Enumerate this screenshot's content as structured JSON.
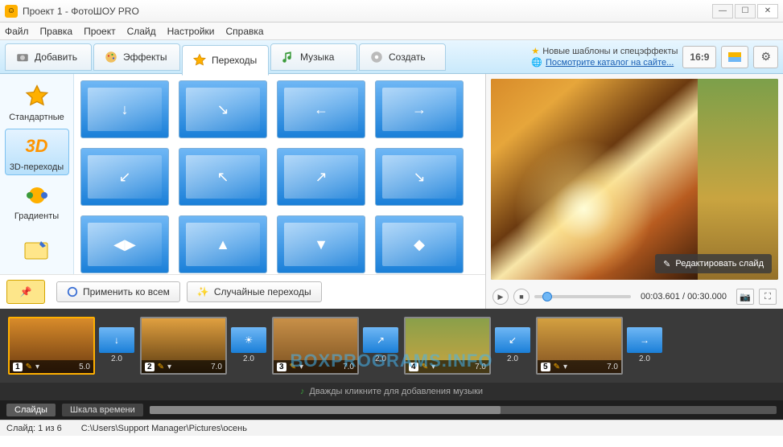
{
  "window": {
    "title": "Проект 1 - ФотоШОУ PRO"
  },
  "menu": [
    "Файл",
    "Правка",
    "Проект",
    "Слайд",
    "Настройки",
    "Справка"
  ],
  "tabs": [
    {
      "label": "Добавить",
      "icon": "camera-icon"
    },
    {
      "label": "Эффекты",
      "icon": "palette-icon"
    },
    {
      "label": "Переходы",
      "icon": "star-icon"
    },
    {
      "label": "Музыка",
      "icon": "note-icon"
    },
    {
      "label": "Создать",
      "icon": "disc-icon"
    }
  ],
  "active_tab": 2,
  "promo": {
    "line1": "Новые шаблоны и спецэффекты",
    "line2": "Посмотрите каталог на сайте..."
  },
  "aspect": "16:9",
  "categories": [
    {
      "label": "Стандартные",
      "icon": "star"
    },
    {
      "label": "3D-переходы",
      "icon": "3d"
    },
    {
      "label": "Градиенты",
      "icon": "grad"
    }
  ],
  "selected_category": 1,
  "buttons": {
    "apply_all": "Применить ко всем",
    "random": "Случайные переходы"
  },
  "preview": {
    "edit": "Редактировать слайд",
    "time_current": "00:03.601",
    "time_total": "00:30.000"
  },
  "timeline": {
    "slides": [
      {
        "n": "1",
        "dur": "5.0"
      },
      {
        "n": "2",
        "dur": "7.0"
      },
      {
        "n": "3",
        "dur": "7.0"
      },
      {
        "n": "4",
        "dur": "7.0"
      },
      {
        "n": "5",
        "dur": "7.0"
      }
    ],
    "trans_dur": "2.0",
    "music_hint": "Дважды кликните для добавления музыки",
    "tabs": [
      "Слайды",
      "Шкала времени"
    ],
    "watermark": "BOXPROGRAMS.INFO"
  },
  "status": {
    "slide": "Слайд: 1 из 6",
    "path": "C:\\Users\\Support Manager\\Pictures\\осень"
  }
}
